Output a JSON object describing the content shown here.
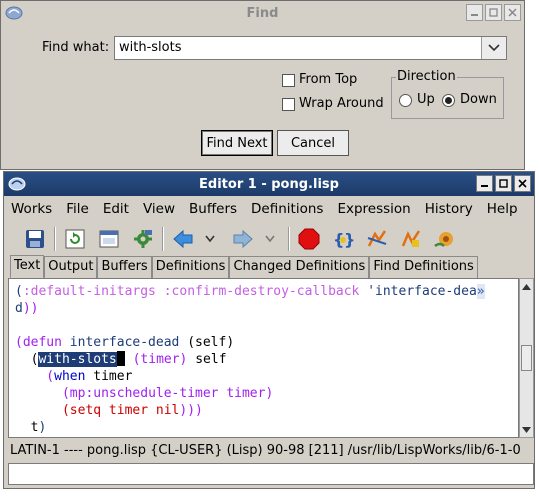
{
  "find_dialog": {
    "title": "Find",
    "find_what_label": "Find what:",
    "find_what_value": "with-slots",
    "from_top": "From Top",
    "wrap_around": "Wrap Around",
    "direction_label": "Direction",
    "up_label": "Up",
    "down_label": "Down",
    "direction_selected": "Down",
    "find_next": "Find Next",
    "cancel": "Cancel"
  },
  "editor": {
    "title": "Editor 1 - pong.lisp",
    "menu": [
      "Works",
      "File",
      "Edit",
      "View",
      "Buffers",
      "Definitions",
      "Expression",
      "History",
      "Help"
    ],
    "toolbar_icons": [
      "save-icon",
      "revert-icon",
      "window-icon",
      "gear-icon",
      "back-arrow-icon",
      "back-menu-icon",
      "forward-arrow-icon",
      "forward-menu-icon",
      "stop-icon",
      "debug-icon",
      "inspect-icon",
      "trace-icon",
      "profile-icon"
    ],
    "tabs": [
      "Text",
      "Output",
      "Buffers",
      "Definitions",
      "Changed Definitions",
      "Find Definitions"
    ],
    "active_tab": "Text",
    "status": "LATIN-1 ---- pong.lisp    {CL-USER} (Lisp) 90-98 [211] /usr/lib/LispWorks/lib/6-1-0"
  },
  "code": {
    "l1_a": "(",
    "l1_b": ":default-initargs :confirm-destroy-callback",
    "l1_c": " 'interface-dea",
    "l1_more": "»",
    "l2_a": "d",
    "l2_b": "))",
    "l4_a": "(",
    "l4_b": "defun",
    "l4_c": " interface-dead ",
    "l4_d": "(self)",
    "l5_a": "  (",
    "l5_b": "with-slots",
    "l5_c": " (timer)",
    "l5_d": " self",
    "l6_a": "    (",
    "l6_b": "when",
    "l6_c": " timer",
    "l7_a": "      (",
    "l7_b": "mp:unschedule-timer timer",
    "l7_c": ")",
    "l8_a": "      (",
    "l8_b": "setq timer nil",
    "l8_c": ")))",
    "l9_a": "  t",
    "l9_b": ")"
  }
}
